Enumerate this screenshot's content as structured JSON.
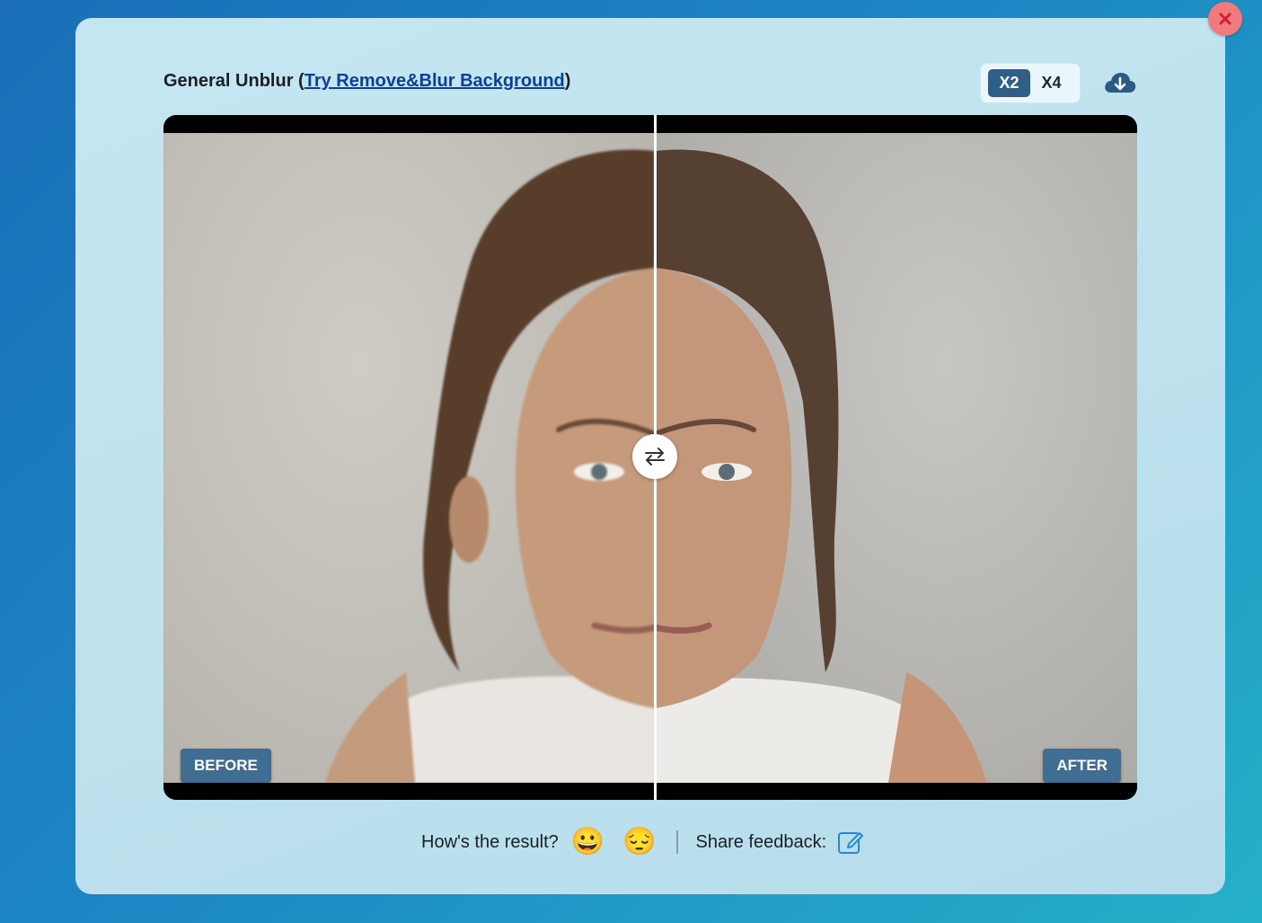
{
  "header": {
    "title_prefix": "General Unblur (",
    "link_label": "Try Remove&Blur Background",
    "title_suffix": ")"
  },
  "scale": {
    "options": [
      "X2",
      "X4"
    ],
    "selected": "X2"
  },
  "viewer": {
    "before_label": "BEFORE",
    "after_label": "AFTER"
  },
  "feedback": {
    "question": "How's the result?",
    "positive_emoji": "😀",
    "negative_emoji": "😔",
    "share_label": "Share feedback:"
  },
  "colors": {
    "accent": "#2f5e87",
    "link": "#0d3e9c",
    "close": "#f07a7e",
    "tag": "#3f6e92"
  },
  "icons": [
    "close-icon",
    "cloud-download-icon",
    "swap-arrows-icon",
    "edit-icon"
  ]
}
